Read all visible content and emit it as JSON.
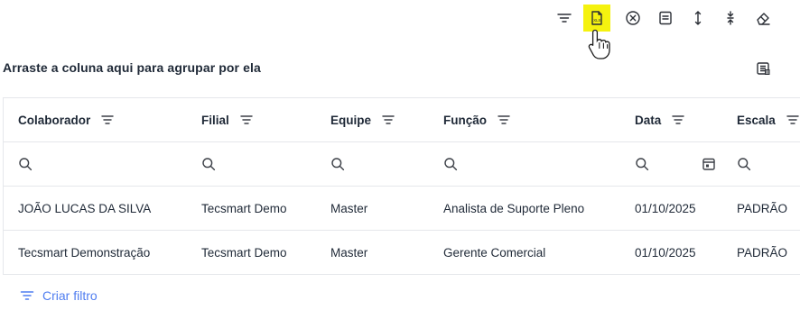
{
  "toolbar": {
    "icons": [
      "filter-icon",
      "export-xls-icon",
      "clear-icon",
      "columns-icon",
      "expand-rows-icon",
      "collapse-rows-icon",
      "eraser-icon"
    ],
    "highlight_color": "#f5f20f",
    "export_badge": "XLS"
  },
  "group_panel": {
    "hint": "Arraste a coluna aqui para agrupar por ela"
  },
  "grid": {
    "columns": [
      "Colaborador",
      "Filial",
      "Equipe",
      "Função",
      "Data",
      "Escala"
    ],
    "rows": [
      [
        "JOÃO LUCAS DA SILVA",
        "Tecsmart Demo",
        "Master",
        "Analista de Suporte Pleno",
        "01/10/2025",
        "PADRÃO"
      ],
      [
        "Tecsmart Demonstração",
        "Tecsmart Demo",
        "Master",
        "Gerente Comercial",
        "01/10/2025",
        "PADRÃO"
      ]
    ]
  },
  "footer": {
    "create_filter_label": "Criar filtro",
    "accent_color": "#4f7df0"
  }
}
